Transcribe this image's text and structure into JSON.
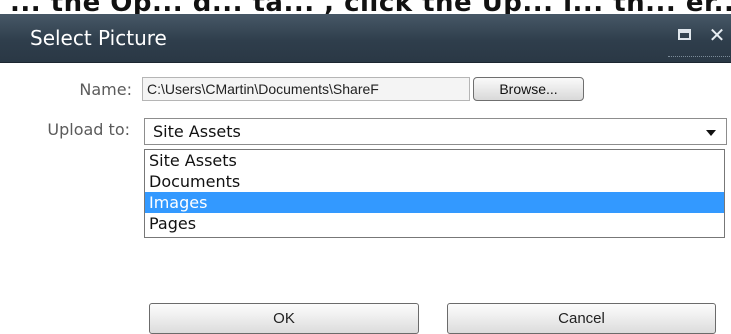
{
  "background_caption": "... the Op... d... ta... , click the Up... l... th... er... ro...",
  "dialog": {
    "title": "Select Picture",
    "maximize_icon": "maximize-icon",
    "close_glyph": "✕",
    "name_label": "Name:",
    "file_path": "C:\\Users\\CMartin\\Documents\\ShareF",
    "browse_label": "Browse...",
    "upload_label": "Upload to:",
    "upload_selected": "Site Assets",
    "upload_options": [
      "Site Assets",
      "Documents",
      "Images",
      "Pages"
    ],
    "highlighted_option": "Images",
    "ok_label": "OK",
    "cancel_label": "Cancel"
  },
  "colors": {
    "titlebar": "#2f3e4c",
    "highlight": "#3399ff"
  }
}
